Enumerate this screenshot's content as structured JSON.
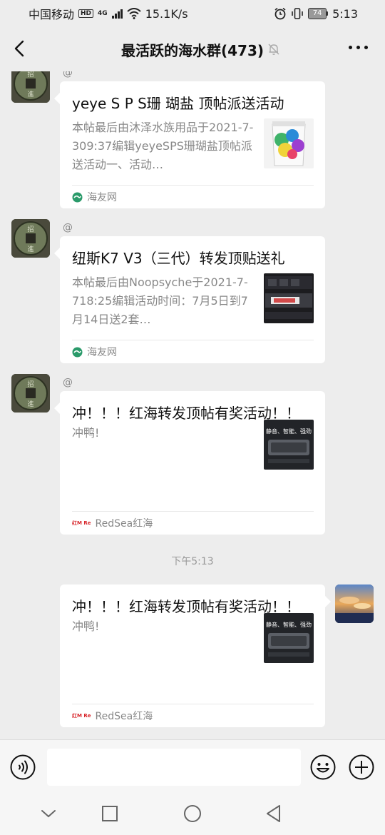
{
  "status_bar": {
    "carrier": "中国移动",
    "hd": "HD",
    "network": "4G",
    "speed": "15.1K/s",
    "battery": "74",
    "time": "5:13"
  },
  "header": {
    "title": "最活跃的海水群(473)",
    "back_icon": "chevron-left-icon",
    "mute_icon": "bell-off-icon",
    "more_icon": "more-dots-icon"
  },
  "messages": [
    {
      "sender": "@",
      "title": "yeye S P S珊 瑚盐 顶帖派送活动",
      "desc": "本帖最后由沐泽水族用品于2021-7-309:37编辑yeyeSPS珊瑚盐顶帖派送活动一、活动…",
      "source": "海友网"
    },
    {
      "sender": "@",
      "title": "纽斯K7 V3（三代）转发顶贴送礼",
      "desc": "本帖最后由Noopsyche于2021-7-718:25编辑活动时间：7月5日到7月14日送2套…",
      "source": "海友网"
    },
    {
      "sender": "@",
      "title": "冲！！！红海转发顶帖有奖活动！！",
      "desc": "冲鸭!",
      "source": "RedSea红海",
      "thumb_text": "静音、智能、强劲",
      "brand_mark": "红M Re"
    }
  ],
  "timestamp": "下午5:13",
  "own_message": {
    "title": "冲！！！红海转发顶帖有奖活动！！",
    "desc": "冲鸭!",
    "source": "RedSea红海",
    "thumb_text": "静音、智能、强劲",
    "brand_mark": "红M Re"
  },
  "input_bar": {
    "placeholder": "",
    "voice_icon": "voice-icon",
    "emoji_icon": "emoji-icon",
    "plus_icon": "plus-circle-icon"
  },
  "system_nav": [
    "chevron-down-icon",
    "square-icon",
    "circle-icon",
    "triangle-back-icon"
  ],
  "colors": {
    "background": "#ededed",
    "card": "#ffffff",
    "source_green": "#2a9a6a",
    "redsea_red": "#d8262b"
  }
}
